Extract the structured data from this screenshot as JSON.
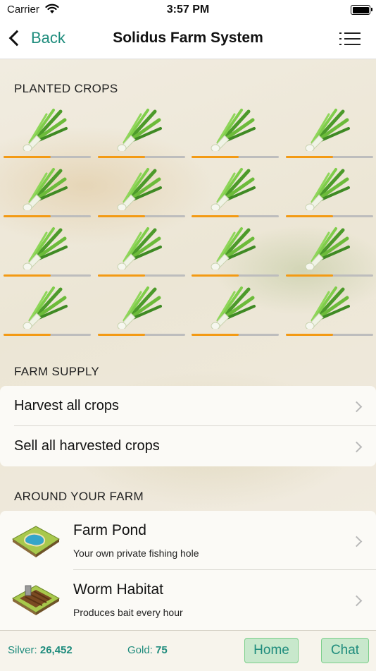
{
  "status_bar": {
    "carrier": "Carrier",
    "time": "3:57 PM"
  },
  "nav": {
    "back_label": "Back",
    "title": "Solidus Farm System"
  },
  "planted_crops": {
    "header": "PLANTED CROPS",
    "crop_icon": "leek-icon",
    "progress_color": "#f39a14",
    "crops": [
      {
        "progress": 0.54
      },
      {
        "progress": 0.54
      },
      {
        "progress": 0.54
      },
      {
        "progress": 0.54
      },
      {
        "progress": 0.54
      },
      {
        "progress": 0.54
      },
      {
        "progress": 0.54
      },
      {
        "progress": 0.54
      },
      {
        "progress": 0.54
      },
      {
        "progress": 0.54
      },
      {
        "progress": 0.54
      },
      {
        "progress": 0.54
      },
      {
        "progress": 0.54
      },
      {
        "progress": 0.54
      },
      {
        "progress": 0.54
      },
      {
        "progress": 0.54
      }
    ]
  },
  "farm_supply": {
    "header": "FARM SUPPLY",
    "items": [
      {
        "label": "Harvest all crops"
      },
      {
        "label": "Sell all harvested crops"
      }
    ]
  },
  "around_farm": {
    "header": "AROUND YOUR FARM",
    "items": [
      {
        "title": "Farm Pond",
        "subtitle": "Your own private fishing hole",
        "icon": "pond-icon"
      },
      {
        "title": "Worm Habitat",
        "subtitle": "Produces bait every hour",
        "icon": "worm-habitat-icon"
      }
    ]
  },
  "bottom_bar": {
    "silver_label": "Silver:",
    "silver_value": "26,452",
    "gold_label": "Gold:",
    "gold_value": "75",
    "home_label": "Home",
    "chat_label": "Chat"
  },
  "colors": {
    "accent": "#1d8c7c",
    "progress": "#f39a14",
    "button_bg": "#c8e8cc"
  }
}
